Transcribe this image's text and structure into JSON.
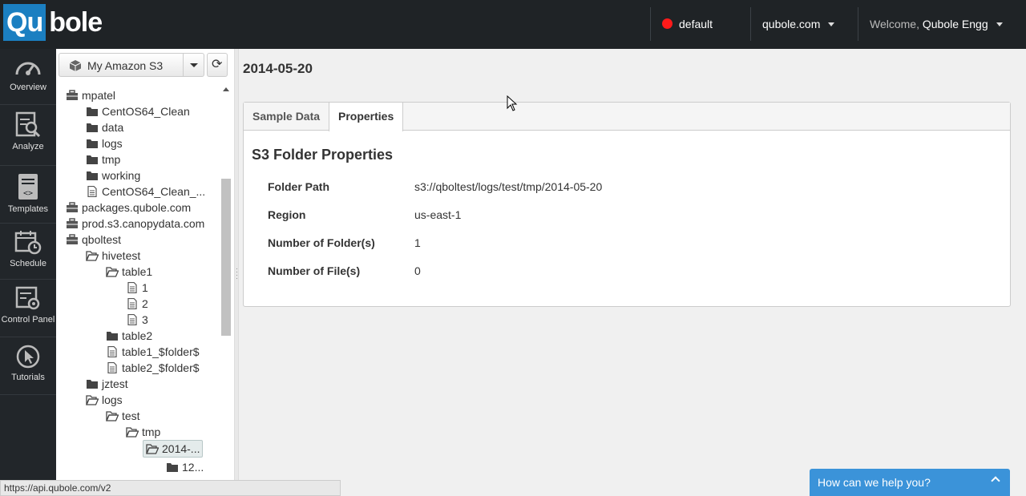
{
  "header": {
    "logo_part1": "Qu",
    "logo_part2": "bole",
    "env_label": "default",
    "env_status_color": "#ff1a1a",
    "account_label": "qubole.com",
    "welcome_prefix": "Welcome,",
    "user_name": "Qubole Engg"
  },
  "nav": {
    "items": [
      {
        "label": "Overview",
        "icon": "speedometer-icon"
      },
      {
        "label": "Analyze",
        "icon": "analyze-icon"
      },
      {
        "label": "Templates",
        "icon": "template-icon"
      },
      {
        "label": "Schedule",
        "icon": "calendar-icon"
      },
      {
        "label": "Control Panel",
        "icon": "control-panel-icon"
      },
      {
        "label": "Tutorials",
        "icon": "cursor-icon"
      }
    ]
  },
  "tree": {
    "bucket_select_label": "My Amazon S3",
    "nodes": [
      {
        "label": "mpatel",
        "type": "bucket",
        "indent": 0
      },
      {
        "label": "CentOS64_Clean",
        "type": "folder",
        "indent": 1
      },
      {
        "label": "data",
        "type": "folder",
        "indent": 1
      },
      {
        "label": "logs",
        "type": "folder",
        "indent": 1
      },
      {
        "label": "tmp",
        "type": "folder",
        "indent": 1
      },
      {
        "label": "working",
        "type": "folder",
        "indent": 1
      },
      {
        "label": "CentOS64_Clean_...",
        "type": "file",
        "indent": 1
      },
      {
        "label": "packages.qubole.com",
        "type": "bucket",
        "indent": 0
      },
      {
        "label": "prod.s3.canopydata.com",
        "type": "bucket",
        "indent": 0
      },
      {
        "label": "qboltest",
        "type": "bucket",
        "indent": 0
      },
      {
        "label": "hivetest",
        "type": "folder-open",
        "indent": 1
      },
      {
        "label": "table1",
        "type": "folder-open",
        "indent": 2
      },
      {
        "label": "1",
        "type": "file",
        "indent": 3
      },
      {
        "label": "2",
        "type": "file",
        "indent": 3
      },
      {
        "label": "3",
        "type": "file",
        "indent": 3
      },
      {
        "label": "table2",
        "type": "folder",
        "indent": 2
      },
      {
        "label": "table1_$folder$",
        "type": "file",
        "indent": 2
      },
      {
        "label": "table2_$folder$",
        "type": "file",
        "indent": 2
      },
      {
        "label": "jztest",
        "type": "folder",
        "indent": 1
      },
      {
        "label": "logs",
        "type": "folder-open",
        "indent": 1
      },
      {
        "label": "test",
        "type": "folder-open",
        "indent": 2
      },
      {
        "label": "tmp",
        "type": "folder-open",
        "indent": 3
      },
      {
        "label": "2014-...",
        "type": "folder-open",
        "indent": 4,
        "selected": true
      },
      {
        "label": "12...",
        "type": "folder",
        "indent": 5
      }
    ]
  },
  "main": {
    "title": "2014-05-20",
    "tabs": [
      {
        "label": "Sample Data",
        "active": false
      },
      {
        "label": "Properties",
        "active": true
      }
    ],
    "props_title": "S3 Folder Properties",
    "properties": [
      {
        "key": "Folder Path",
        "value": "s3://qboltest/logs/test/tmp/2014-05-20"
      },
      {
        "key": "Region",
        "value": "us-east-1"
      },
      {
        "key": "Number of Folder(s)",
        "value": "1"
      },
      {
        "key": "Number of File(s)",
        "value": "0"
      }
    ]
  },
  "status_url": "https://api.qubole.com/v2",
  "help_widget_label": "How can we help you?"
}
